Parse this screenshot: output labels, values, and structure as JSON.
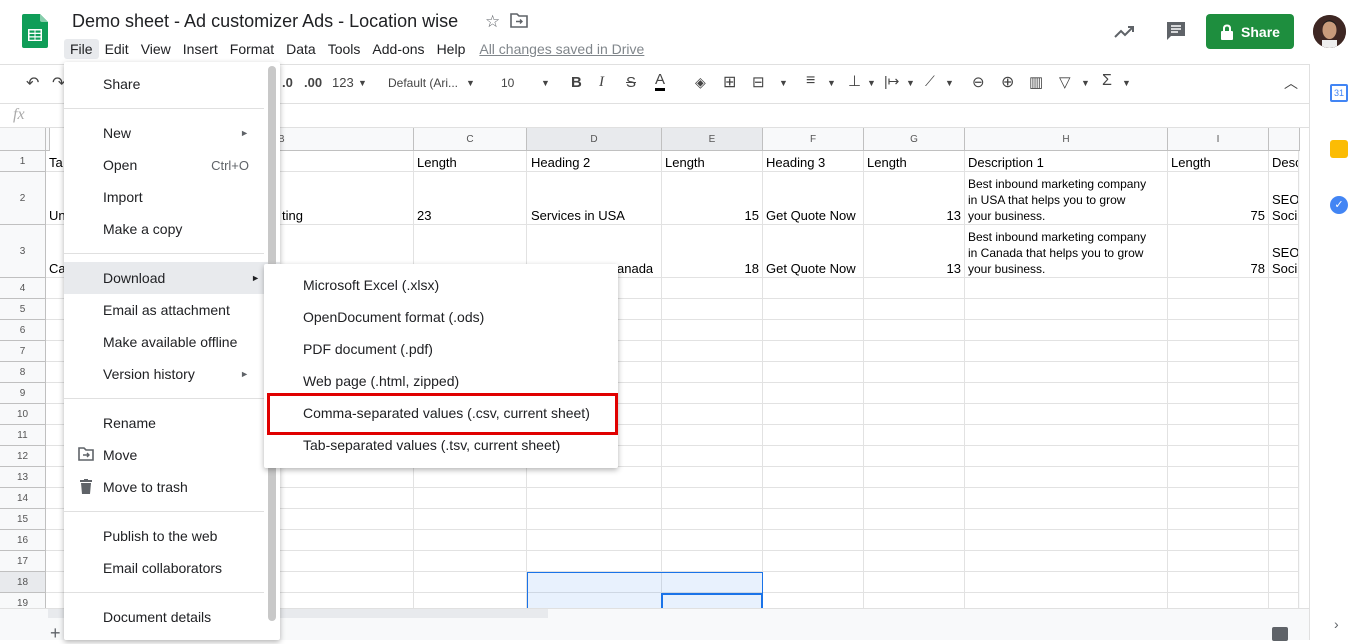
{
  "doc": {
    "title": "Demo sheet - Ad customizer Ads - Location wise",
    "saved_status": "All changes saved in Drive"
  },
  "menubar": [
    "File",
    "Edit",
    "View",
    "Insert",
    "Format",
    "Data",
    "Tools",
    "Add-ons",
    "Help"
  ],
  "header": {
    "share_label": "Share"
  },
  "toolbar": {
    "decimal_dec": ".0",
    "decimal_inc": ".00",
    "number_format": "123",
    "font": "Default (Ari...",
    "font_size": "10"
  },
  "formula_bar": {
    "fx": "fx"
  },
  "columns": [
    "B",
    "C",
    "D",
    "E",
    "F",
    "G",
    "H",
    "I"
  ],
  "rows": [
    "1",
    "2",
    "3",
    "4",
    "5",
    "6",
    "7",
    "8",
    "9",
    "10",
    "11",
    "12",
    "13",
    "14",
    "15",
    "16",
    "17",
    "18",
    "19"
  ],
  "cells": {
    "a1": "Ta",
    "c1": "Length",
    "d1": "Heading 2",
    "e1": "Length",
    "f1": "Heading 3",
    "g1": "Length",
    "h1": "Description 1",
    "i1": "Length",
    "j1": "Desc",
    "a2": "Un",
    "b2": "ting",
    "c2": "23",
    "d2": "Services in USA",
    "e2": "15",
    "f2": "Get Quote Now",
    "g2": "13",
    "h2_l1": "Best inbound marketing company",
    "h2_l2": "in USA that helps you to grow",
    "h2_l3": "your business.",
    "i2": "75",
    "j2_l1": "SEO",
    "j2_l2": "Soci",
    "a3": "Ca",
    "d3": "anada",
    "e3": "18",
    "f3": "Get Quote Now",
    "g3": "13",
    "h3_l1": "Best inbound marketing company",
    "h3_l2": "in Canada that helps you to grow",
    "h3_l3": "your business.",
    "i3": "78",
    "j3_l1": "SEO",
    "j3_l2": "Soci"
  },
  "file_menu": {
    "share": "Share",
    "new": "New",
    "open": "Open",
    "open_shortcut": "Ctrl+O",
    "import": "Import",
    "make_copy": "Make a copy",
    "download": "Download",
    "email_attachment": "Email as attachment",
    "offline": "Make available offline",
    "version_history": "Version history",
    "rename": "Rename",
    "move": "Move",
    "trash": "Move to trash",
    "publish": "Publish to the web",
    "email_collab": "Email collaborators",
    "details": "Document details"
  },
  "download_menu": [
    "Microsoft Excel (.xlsx)",
    "OpenDocument format (.ods)",
    "PDF document (.pdf)",
    "Web page (.html, zipped)",
    "Comma-separated values (.csv, current sheet)",
    "Tab-separated values (.tsv, current sheet)"
  ],
  "colors": {
    "accent": "#1e8e3e",
    "highlight": "#e00000",
    "selection": "#1a73e8"
  }
}
